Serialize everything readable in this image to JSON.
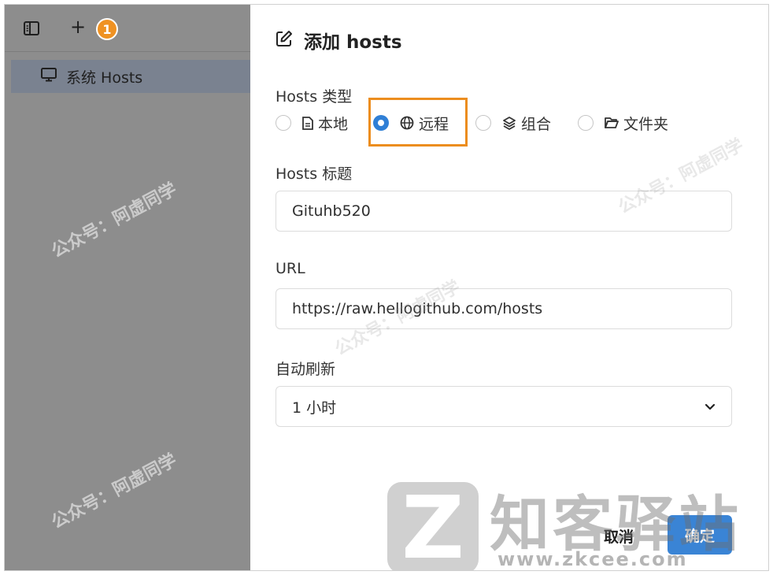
{
  "sidebar": {
    "add_symbol": "+",
    "badge": "1",
    "system_hosts_label": "系统 Hosts"
  },
  "form": {
    "title": "添加 hosts",
    "type_label": "Hosts 类型",
    "type_options": [
      {
        "label": "本地",
        "icon": "document-icon",
        "checked": false
      },
      {
        "label": "远程",
        "icon": "globe-icon",
        "checked": true
      },
      {
        "label": "组合",
        "icon": "layers-icon",
        "checked": false
      },
      {
        "label": "文件夹",
        "icon": "folder-icon",
        "checked": false
      }
    ],
    "title_label": "Hosts 标题",
    "title_value": "Gituhb520",
    "url_label": "URL",
    "url_value": "https://raw.hellogithub.com/hosts",
    "refresh_label": "自动刷新",
    "refresh_value": "1 小时",
    "cancel_label": "取消",
    "ok_label": "确定"
  },
  "watermark": {
    "wechat_text": "公众号：阿虚同学",
    "brand_text": "知客驿站",
    "brand_url": "www.zkcee.com"
  },
  "colors": {
    "accent": "#3a84d5",
    "highlight": "#ec8d1e",
    "badge": "#ef9223",
    "overlay": "#8d8d8d"
  }
}
